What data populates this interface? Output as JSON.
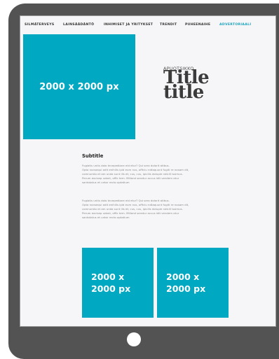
{
  "nav": {
    "items": [
      {
        "label": "SILMÄTERVEYS"
      },
      {
        "label": "LAINSÄÄDÄNTÖ"
      },
      {
        "label": "INHIMISET JA YRITYKSET"
      },
      {
        "label": "TRENDIT"
      },
      {
        "label": "PUHEENAIHE"
      },
      {
        "label": "ADVERTORIAALI"
      }
    ],
    "active_color": "#1aa3bd"
  },
  "hero": {
    "image_label": "2000 x 2000 px",
    "color": "#01a8c2"
  },
  "article": {
    "kicker": "APUOTSIKKO",
    "title_line1": "Title",
    "title_line2": "title",
    "subtitle": "Subtitle",
    "paragraph1": [
      "Fugiatis untis dolo tecepedione eid etur? Qui sero dolorit atibus.",
      "Opta nonsequi adit enihilis ipid eum nus, officiu ndtaquunt fugiti re nosam dit,",
      "comnumto et am unda sunt ills et; cus, cus, ipicilis dolupie ndicill issimus.",
      "Perum excisep udant, offic tem. Milland seratur accus idit vendem atur",
      "santotatus et untor recto optatium"
    ],
    "paragraph2": [
      "Fugiatis untis dolo tecepedione eid etur? Qui sero dolorit atibus.",
      "Opta nonsequi adit enihilis ipid eum nus, officiu ndtaquunt fugiti re nosam dit,",
      "comnumto et am unda sunt ills et; cus, cus, ipicilis dolupie ndicill issimus.",
      "Perum excisep udant, offic tem. Milland seratur accus idit vendem atur",
      "santotatus et untor recto optatium"
    ]
  },
  "tiles": [
    {
      "line1": "2000 x",
      "line2": "2000 px"
    },
    {
      "line1": "2000 x",
      "line2": "2000 px"
    }
  ],
  "device": {
    "frame_color": "#535353"
  }
}
